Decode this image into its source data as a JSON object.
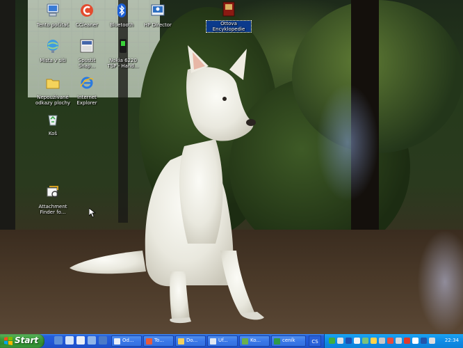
{
  "desktop": {
    "icons": [
      {
        "label": "Tento počítač"
      },
      {
        "label": "CCleaner"
      },
      {
        "label": "Bluetooth"
      },
      {
        "label": "HP Director"
      },
      {
        "label": "Ottova\nEncyklopedie"
      },
      {
        "label": "Místa v síti"
      },
      {
        "label": "Spustit\nSnap..."
      },
      {
        "label": "Nokia 6220\nTSP - Hand..."
      },
      {
        "label": "Nepoužívané\nodkazy plochy"
      },
      {
        "label": "Internet\nExplorer"
      },
      {
        "label": "Koš"
      },
      {
        "label": "Attachment\nFinder fo..."
      }
    ]
  },
  "taskbar": {
    "start_label": "Start",
    "tasks": [
      {
        "label": "Od..."
      },
      {
        "label": "To..."
      },
      {
        "label": "Do..."
      },
      {
        "label": "Uf..."
      },
      {
        "label": "Ko..."
      },
      {
        "label": "ceník"
      }
    ],
    "language": "CS",
    "clock": "22:34"
  },
  "colors": {
    "taskbar_blue": "#245edb",
    "start_green": "#3c9a3c",
    "tray_blue": "#0f8ce6"
  }
}
